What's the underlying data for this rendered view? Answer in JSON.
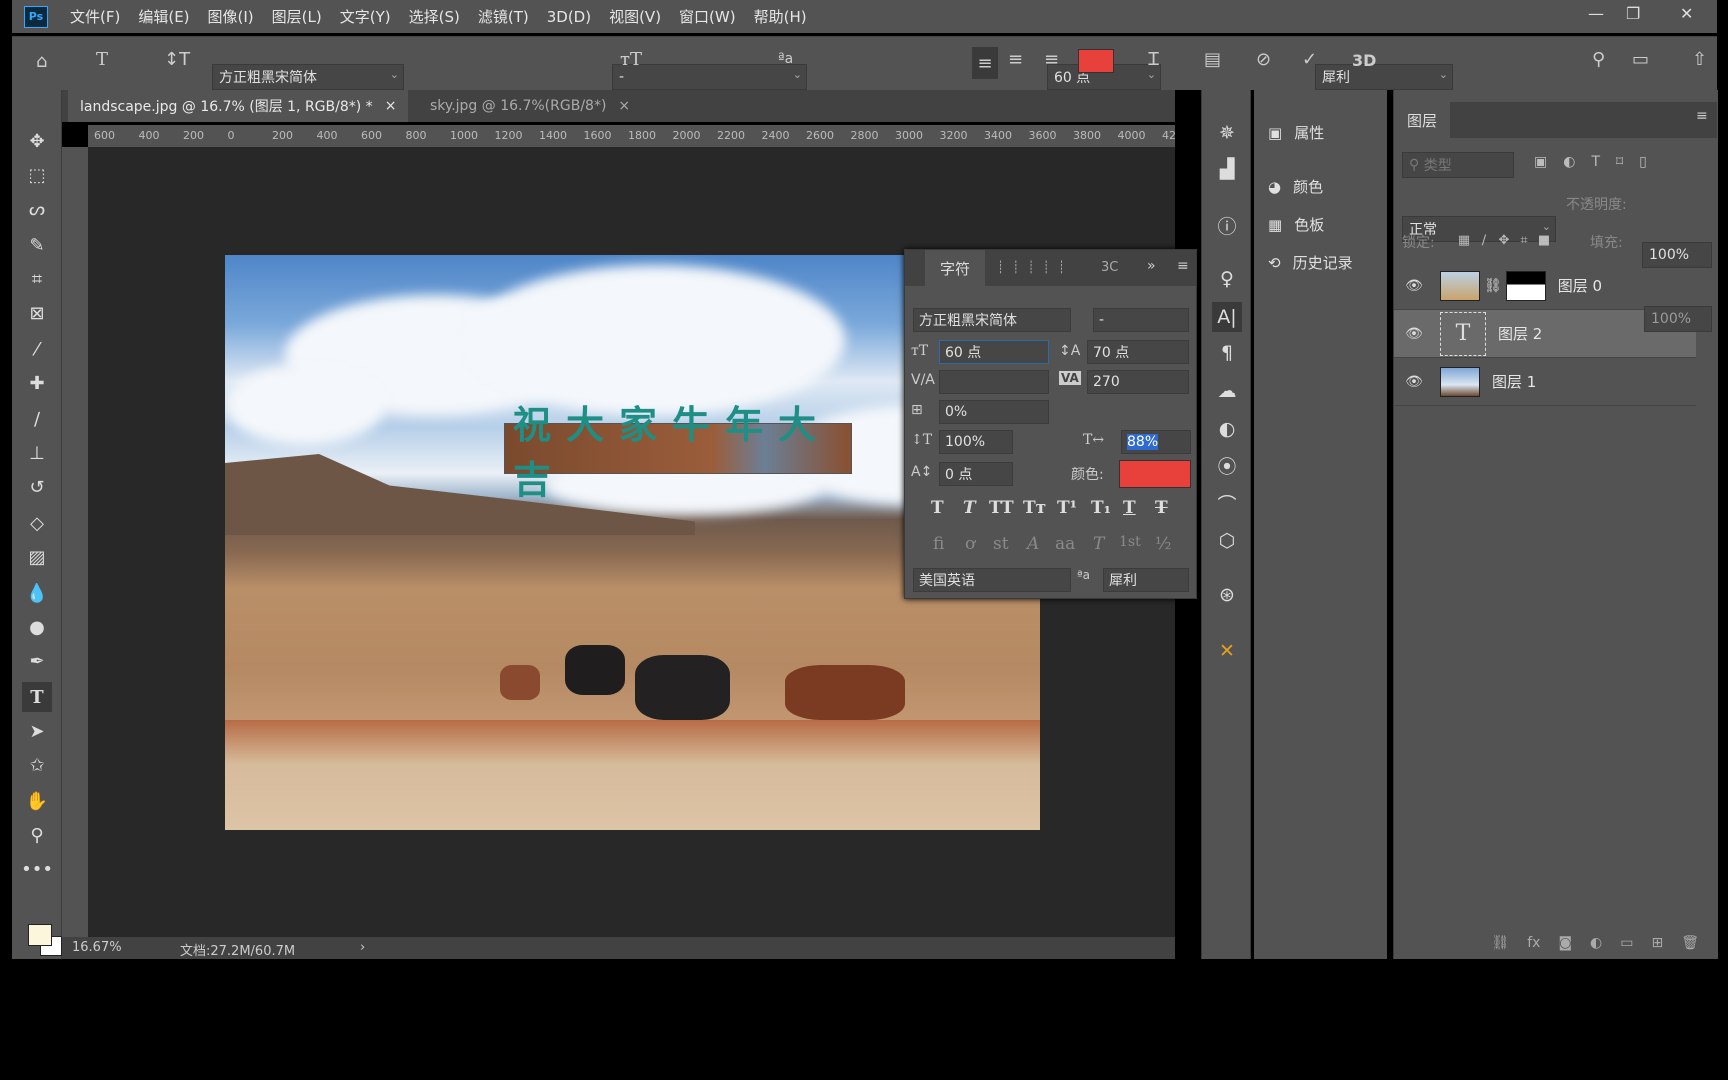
{
  "app": {
    "logo": "Ps"
  },
  "menu": [
    "文件(F)",
    "编辑(E)",
    "图像(I)",
    "图层(L)",
    "文字(Y)",
    "选择(S)",
    "滤镜(T)",
    "3D(D)",
    "视图(V)",
    "窗口(W)",
    "帮助(H)"
  ],
  "window_controls": {
    "minimize": "—",
    "restore": "❐",
    "close": "✕"
  },
  "options": {
    "font_family": "方正粗黑宋简体",
    "font_style": "-",
    "font_size": "60 点",
    "antialias": "犀利",
    "text_color": "#e8403a",
    "threed_label": "3D"
  },
  "tabs": [
    {
      "label": "landscape.jpg @ 16.7% (图层 1, RGB/8*) *",
      "active": true
    },
    {
      "label": "sky.jpg @ 16.7%(RGB/8*)",
      "active": false
    }
  ],
  "ruler": [
    "600",
    "400",
    "200",
    "0",
    "200",
    "400",
    "600",
    "800",
    "1000",
    "1200",
    "1400",
    "1600",
    "1800",
    "2000",
    "2200",
    "2400",
    "2600",
    "2800",
    "3000",
    "3200",
    "3400",
    "3600",
    "3800",
    "4000",
    "42"
  ],
  "canvas": {
    "text_layer": "祝大家牛年大吉"
  },
  "status": {
    "zoom": "16.67%",
    "doc": "文档:27.2M/60.7M"
  },
  "colors": {
    "foreground": "#fbf6dc",
    "background": "#ffffff"
  },
  "character_panel": {
    "tab": "字符",
    "tab_3d": "3C",
    "font_family": "方正粗黑宋简体",
    "font_style": "-",
    "size": "60 点",
    "leading": "70 点",
    "kerning": "",
    "tracking": "270",
    "tsume": "0%",
    "vertical_scale": "100%",
    "horizontal_scale": "88%",
    "baseline_shift": "0 点",
    "color_label": "颜色:",
    "color": "#e8403a",
    "language": "美国英语",
    "antialias": "犀利",
    "style_buttons": [
      "T",
      "T",
      "TT",
      "Tт",
      "T¹",
      "T₁",
      "T",
      "T"
    ],
    "opentype_buttons": [
      "fi",
      "ơ",
      "st",
      "A",
      "aa",
      "T",
      "1st",
      "½"
    ]
  },
  "properties_panel": [
    {
      "icon": "properties-icon",
      "label": "属性"
    },
    {
      "icon": "color-icon",
      "label": "颜色"
    },
    {
      "icon": "swatches-icon",
      "label": "色板"
    },
    {
      "icon": "history-icon",
      "label": "历史记录"
    }
  ],
  "layers_panel": {
    "title": "图层",
    "filter_placeholder": "类型",
    "blend_mode": "正常",
    "opacity_label": "不透明度:",
    "opacity": "100%",
    "lock_label": "锁定:",
    "fill_label": "填充:",
    "fill": "100%",
    "layers": [
      {
        "name": "图层 0",
        "type": "image-with-mask",
        "visible": true,
        "selected": false
      },
      {
        "name": "图层 2",
        "type": "text",
        "visible": true,
        "selected": true
      },
      {
        "name": "图层 1",
        "type": "image",
        "visible": true,
        "selected": false
      }
    ]
  }
}
